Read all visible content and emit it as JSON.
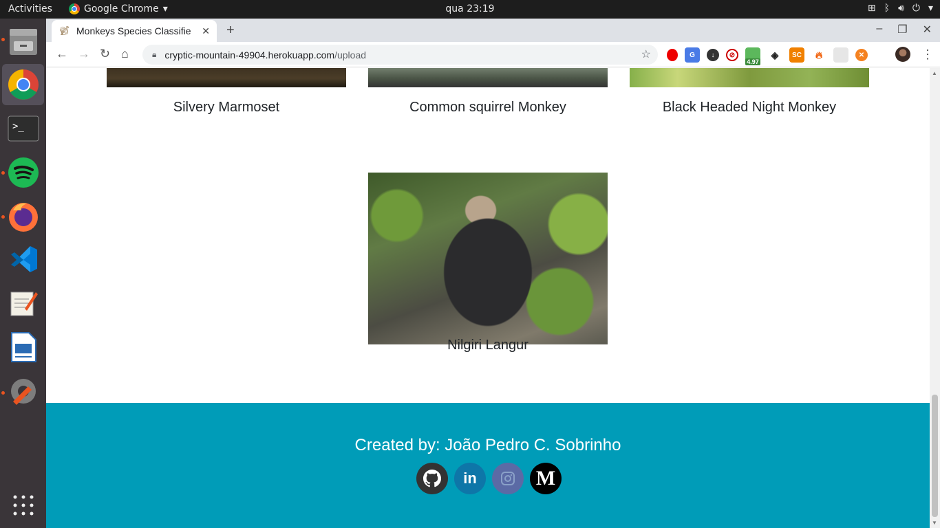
{
  "topbar": {
    "activities": "Activities",
    "app_name": "Google Chrome",
    "clock": "qua 23:19"
  },
  "browser": {
    "tab_title": "Monkeys Species Classifie",
    "url_host": "cryptic-mountain-49904.herokuapp.com",
    "url_path": "/upload",
    "extension_badge": "4.97",
    "extension_sc": "SC"
  },
  "page": {
    "cards": [
      {
        "label": "Silvery Marmoset"
      },
      {
        "label": "Common squirrel Monkey"
      },
      {
        "label": "Black Headed Night Monkey"
      },
      {
        "label": "Nilgiri Langur"
      }
    ],
    "footer": {
      "credit": "Created by: João Pedro C. Sobrinho",
      "social": [
        {
          "name": "github-icon",
          "color": "#333333"
        },
        {
          "name": "linkedin-icon",
          "color": "#0e76a8",
          "glyph": "in"
        },
        {
          "name": "instagram-icon",
          "color": "#5b6aa5"
        },
        {
          "name": "medium-icon",
          "color": "#000000",
          "glyph": "M"
        }
      ]
    }
  },
  "colors": {
    "footer_bg": "#009cb8",
    "dock_bg": "#3a3539",
    "topbar_bg": "#1d1d1d"
  }
}
